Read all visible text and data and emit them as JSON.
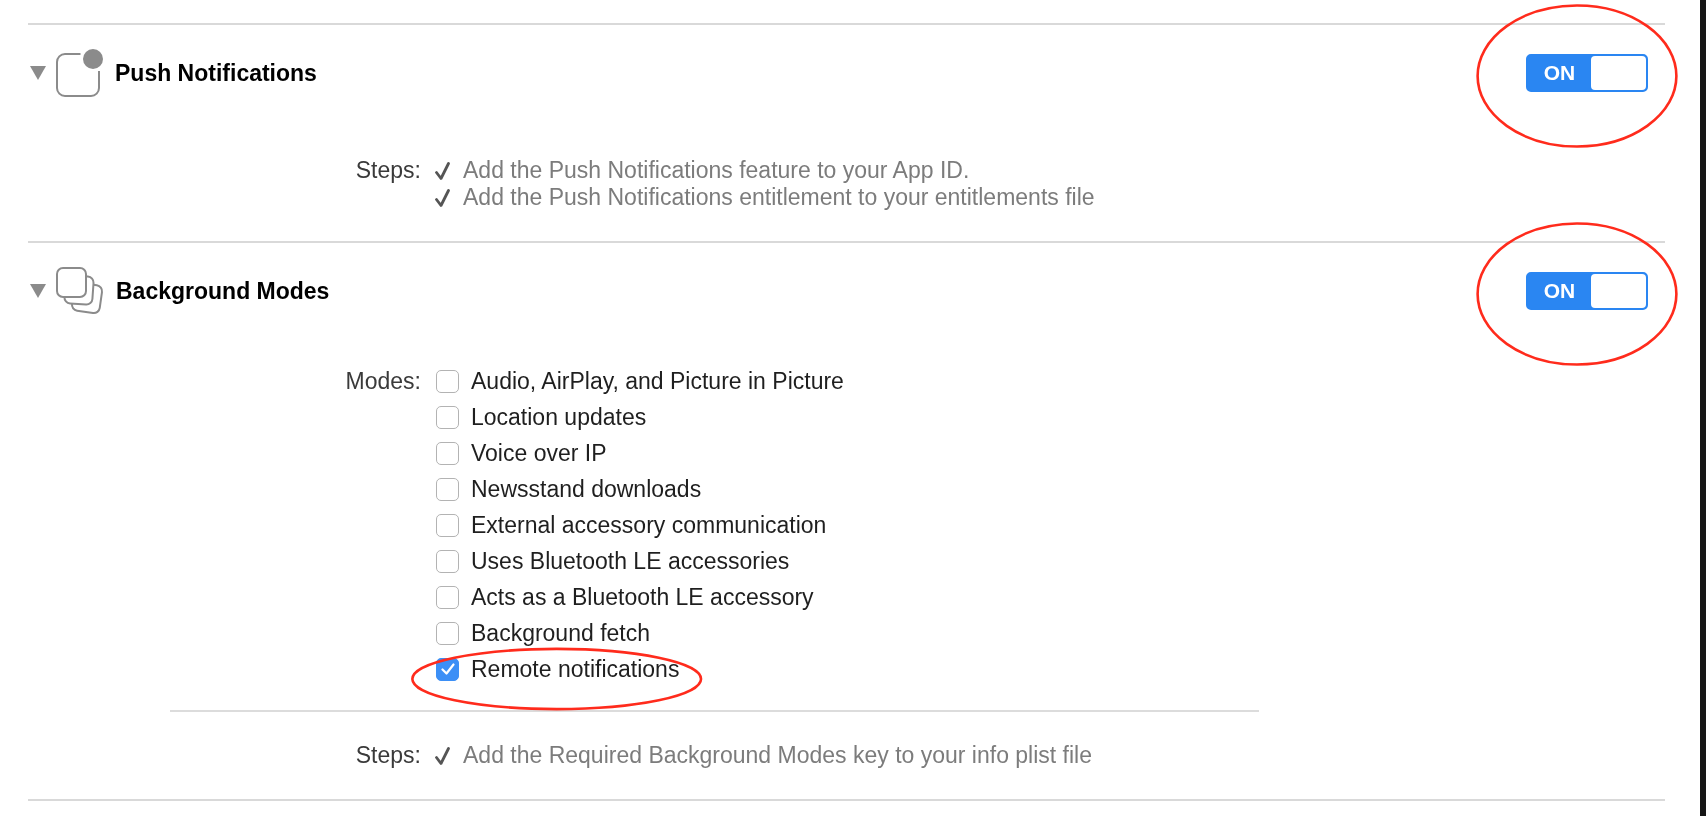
{
  "capabilities": [
    {
      "kind": "push",
      "title": "Push Notifications",
      "expanded": true,
      "switch": {
        "label": "ON",
        "on": true,
        "circled": true
      },
      "steps": {
        "label": "Steps:",
        "items": [
          {
            "text": "Add the Push Notifications feature to your App ID.",
            "done": true
          },
          {
            "text": "Add the Push Notifications entitlement to your entitlements file",
            "done": true
          }
        ]
      }
    },
    {
      "kind": "background",
      "title": "Background Modes",
      "expanded": true,
      "switch": {
        "label": "ON",
        "on": true,
        "circled": true
      },
      "modes": {
        "label": "Modes:",
        "items": [
          {
            "label": "Audio, AirPlay, and Picture in Picture",
            "checked": false,
            "circled": false
          },
          {
            "label": "Location updates",
            "checked": false,
            "circled": false
          },
          {
            "label": "Voice over IP",
            "checked": false,
            "circled": false
          },
          {
            "label": "Newsstand downloads",
            "checked": false,
            "circled": false
          },
          {
            "label": "External accessory communication",
            "checked": false,
            "circled": false
          },
          {
            "label": "Uses Bluetooth LE accessories",
            "checked": false,
            "circled": false
          },
          {
            "label": "Acts as a Bluetooth LE accessory",
            "checked": false,
            "circled": false
          },
          {
            "label": "Background fetch",
            "checked": false,
            "circled": false
          },
          {
            "label": "Remote notifications",
            "checked": true,
            "circled": true
          }
        ]
      },
      "steps": {
        "label": "Steps:",
        "items": [
          {
            "text": "Add the Required Background Modes key to your info plist file",
            "done": true
          }
        ]
      }
    }
  ]
}
